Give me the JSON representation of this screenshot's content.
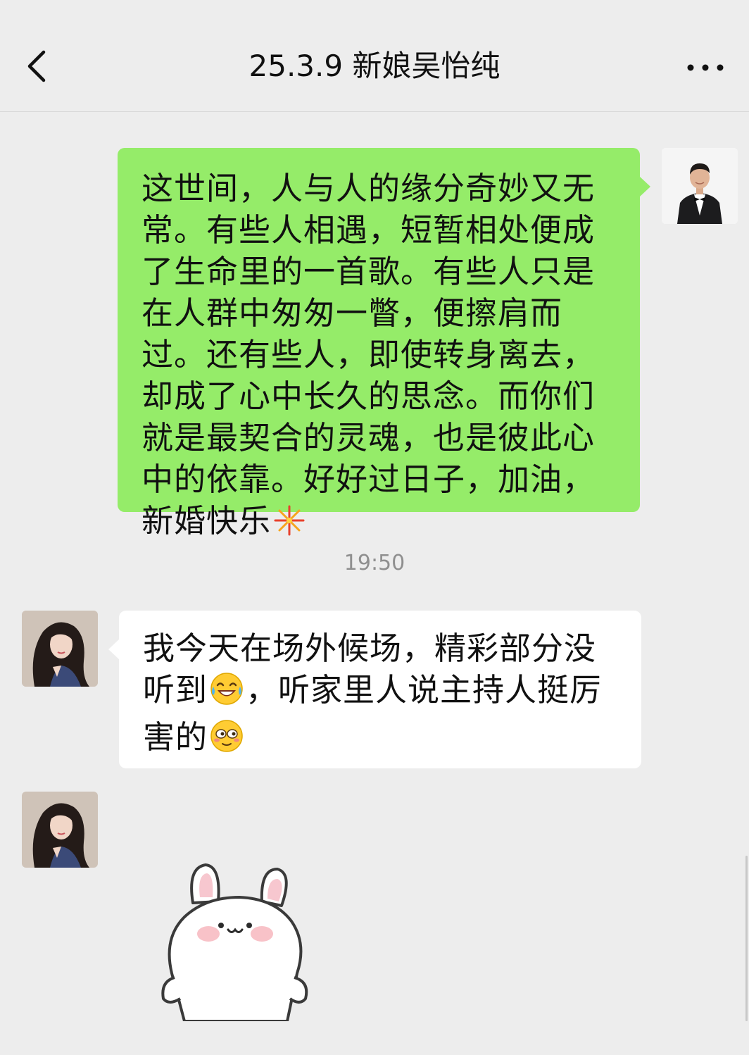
{
  "header": {
    "title": "25.3.9 新娘吴怡纯",
    "back_icon": "chevron-left-icon",
    "more_icon": "more-dots-icon"
  },
  "messages": [
    {
      "sender": "self",
      "text": "这世间，人与人的缘分奇妙又无常。有些人相遇，短暂相处便成了生命里的一首歌。有些人只是在人群中匆匆一瞥，便擦肩而过。还有些人，即使转身离去，却成了心中长久的思念。而你们就是最契合的灵魂，也是彼此心中的依靠。好好过日子，加油，新婚快乐",
      "emoji": "fireworks-emoji"
    },
    {
      "timestamp": "19:50"
    },
    {
      "sender": "bride",
      "text_part1": "我今天在场外候场，精彩部分没听到",
      "emoji1": "laughing-tears-emoji",
      "text_part2": "，听家里人说主持人挺厉害的",
      "emoji2": "dizzy-face-emoji"
    },
    {
      "sender": "bride",
      "sticker": "bunny-sticker"
    }
  ],
  "colors": {
    "background": "#ededed",
    "self_bubble": "#95ec69",
    "other_bubble": "#ffffff",
    "timestamp": "#8f8f8f"
  }
}
